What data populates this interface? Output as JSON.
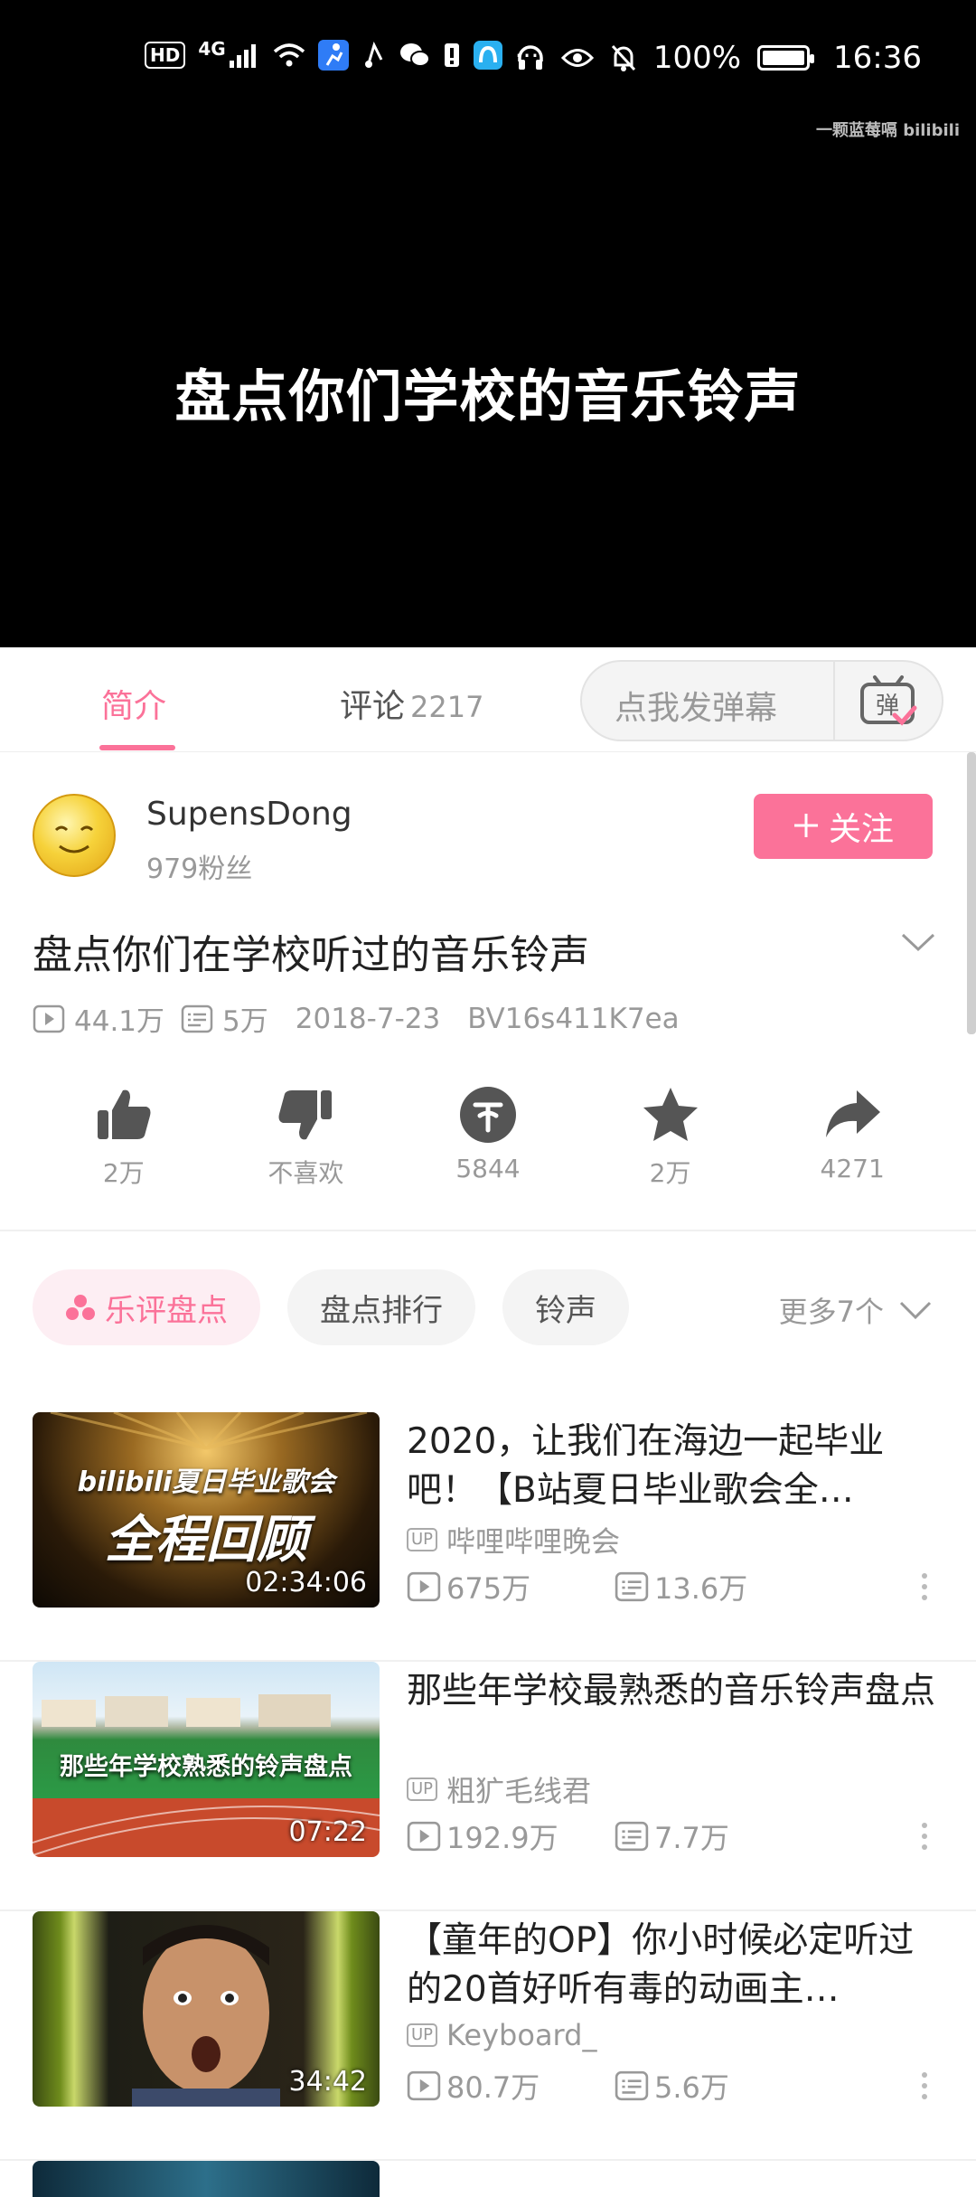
{
  "status_bar": {
    "hd": "HD",
    "network": "4G",
    "battery_pct": "100%",
    "time": "16:36",
    "more": "···"
  },
  "player": {
    "watermark": "一颗蓝莓嗝 bilibili",
    "title_overlay": "盘点你们学校的音乐铃声"
  },
  "tabs": [
    {
      "label": "简介",
      "active": true
    },
    {
      "label": "评论",
      "count": "2217"
    }
  ],
  "danmaku": {
    "placeholder": "点我发弹幕",
    "button_icon": "danmaku-icon"
  },
  "uploader": {
    "name": "SupensDong",
    "fans": "979粉丝",
    "follow_label": "关注"
  },
  "video": {
    "title": "盘点你们在学校听过的音乐铃声",
    "views": "44.1万",
    "danmaku_count": "5万",
    "date": "2018-7-23",
    "bvid": "BV16s411K7ea"
  },
  "actions": [
    {
      "icon": "thumbs-up-icon",
      "label": "2万"
    },
    {
      "icon": "thumbs-down-icon",
      "label": "不喜欢"
    },
    {
      "icon": "coin-icon",
      "label": "5844"
    },
    {
      "icon": "star-icon",
      "label": "2万"
    },
    {
      "icon": "share-icon",
      "label": "4271"
    }
  ],
  "tags": [
    {
      "label": "乐评盘点",
      "active": true
    },
    {
      "label": "盘点排行"
    },
    {
      "label": "铃声"
    }
  ],
  "tags_more": "更多7个",
  "related": [
    {
      "title": "2020，让我们在海边一起毕业吧！【B站夏日毕业歌会全…",
      "uploader": "哔哩哔哩晚会",
      "views": "675万",
      "danmaku": "13.6万",
      "duration": "02:34:06",
      "thumb_line1": "bilibili夏日毕业歌会",
      "thumb_line2": "全程回顾"
    },
    {
      "title": "那些年学校最熟悉的音乐铃声盘点",
      "uploader": "粗犷毛线君",
      "views": "192.9万",
      "danmaku": "7.7万",
      "duration": "07:22",
      "thumb_line1": "那些年学校熟悉的铃声盘点"
    },
    {
      "title": "【童年的OP】你小时候必定听过的20首好听有毒的动画主…",
      "uploader": "Keyboard_",
      "views": "80.7万",
      "danmaku": "5.6万",
      "duration": "34:42"
    }
  ],
  "up_badge": "UP",
  "colors": {
    "accent": "#fb7299",
    "muted": "#999999"
  }
}
